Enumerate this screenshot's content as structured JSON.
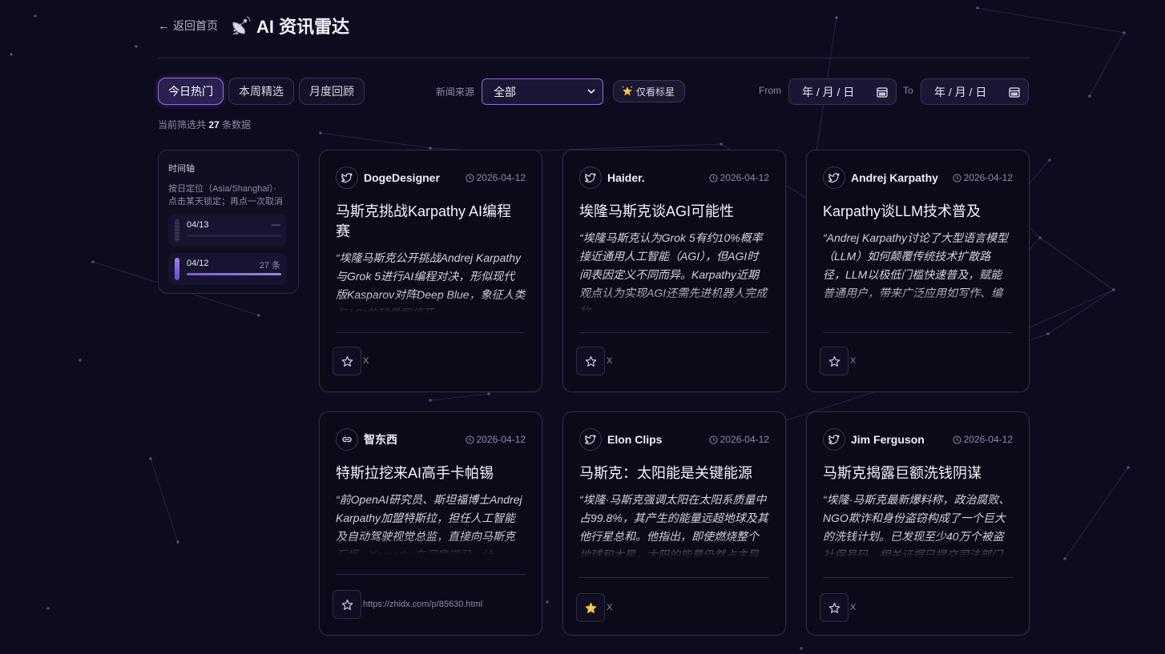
{
  "header": {
    "back_label": "返回首页",
    "title": "AI 资讯雷达",
    "title_icon": "satellite-dish-icon"
  },
  "tabs": [
    {
      "label": "今日热门",
      "active": true
    },
    {
      "label": "本周精选",
      "active": false
    },
    {
      "label": "月度回顾",
      "active": false
    }
  ],
  "filters": {
    "source_label": "新闻来源",
    "source_selected": "全部",
    "star_only_label": "仅看标星",
    "from_label": "From",
    "to_label": "To",
    "from_value": "年 / 月 / 日",
    "to_value": "年 / 月 / 日"
  },
  "summary": {
    "prefix": "当前筛选共",
    "count": "27",
    "suffix": "条数据"
  },
  "timeline": {
    "title": "时间轴",
    "desc_line1": "按日定位（Asia/Shanghai）·",
    "desc_line2": "点击某天锁定；再点一次取消",
    "items": [
      {
        "date": "04/13",
        "count": "—",
        "fill": 0
      },
      {
        "date": "04/12",
        "count": "27 条",
        "fill": 1
      }
    ]
  },
  "cards": [
    {
      "icon": "twitter-icon",
      "author": "DogeDesigner",
      "date": "2026-04-12",
      "title": "马斯克挑战Karpathy AI编程赛",
      "body": "“埃隆马斯克公开挑战Andrej Karpathy与Grok 5进行AI编程对决，形似现代版Kasparov对阵Deep Blue，象征人类与AGI的较量即将开",
      "source": "X",
      "starred": false
    },
    {
      "icon": "twitter-icon",
      "author": "Haider.",
      "date": "2026-04-12",
      "title": "埃隆马斯克谈AGI可能性",
      "body": "“埃隆马斯克认为Grok 5有约10%概率接近通用人工智能（AGI），但AGI时间表因定义不同而异。Karpathy近期观点认为实现AGI还需先进机器人完成物",
      "source": "X",
      "starred": false
    },
    {
      "icon": "twitter-icon",
      "author": "Andrej Karpathy",
      "date": "2026-04-12",
      "title": "Karpathy谈LLM技术普及",
      "body": "“Andrej Karpathy讨论了大型语言模型（LLM）如何颠覆传统技术扩散路径，LLM以极低门槛快速普及，赋能普通用户，带来广泛应用如写作、编",
      "source": "X",
      "starred": false
    },
    {
      "icon": "link-icon",
      "author": "智东西",
      "date": "2026-04-12",
      "title": "特斯拉挖来AI高手卡帕锡",
      "body": "“前OpenAI研究员、斯坦福博士Andrej Karpathy加盟特斯拉，担任人工智能及自动驾驶视觉总监，直接向马斯克汇报。Karpathy在深度学习、计",
      "source": "https://zhidx.com/p/85630.html",
      "starred": false
    },
    {
      "icon": "twitter-icon",
      "author": "Elon Clips",
      "date": "2026-04-12",
      "title": "马斯克：太阳能是关键能源",
      "body": "“埃隆·马斯克强调太阳在太阳系质量中占99.8%，其产生的能量远超地球及其他行星总和。他指出，即使燃烧整个地球和木星，太阳的能量仍然占主导地",
      "source": "X",
      "starred": true
    },
    {
      "icon": "twitter-icon",
      "author": "Jim Ferguson",
      "date": "2026-04-12",
      "title": "马斯克揭露巨额洗钱阴谋",
      "body": "“埃隆·马斯克最新爆料称，政治腐败、NGO欺诈和身份盗窃构成了一个巨大的洗钱计划。已发现至少40万个被盗社保号码，相关证据已提交司法部门",
      "source": "X",
      "starred": false
    }
  ],
  "colors": {
    "accent": "#8d6fe0",
    "background": "#0d0b1e",
    "star_active": "#f5c542"
  }
}
